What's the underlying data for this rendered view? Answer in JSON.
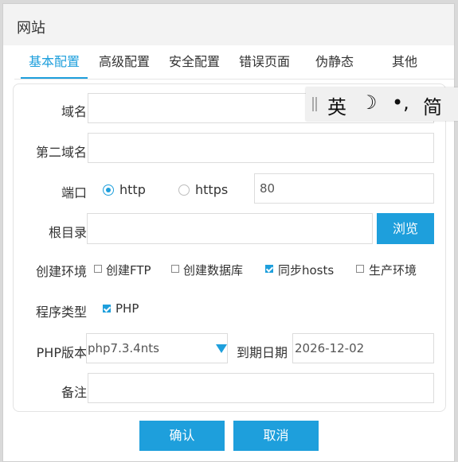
{
  "dialog": {
    "title": "网站"
  },
  "tabs": [
    {
      "label": "基本配置",
      "active": true
    },
    {
      "label": "高级配置"
    },
    {
      "label": "安全配置"
    },
    {
      "label": "错误页面"
    },
    {
      "label": "伪静态"
    },
    {
      "label": "其他"
    }
  ],
  "form": {
    "domain": {
      "label": "域名",
      "value": ""
    },
    "second_domain": {
      "label": "第二域名",
      "value": ""
    },
    "port": {
      "label": "端口",
      "options": [
        {
          "label": "http",
          "selected": true
        },
        {
          "label": "https",
          "selected": false
        }
      ],
      "value": "80"
    },
    "root": {
      "label": "根目录",
      "value": "",
      "browse_label": "浏览"
    },
    "env": {
      "label": "创建环境",
      "options": [
        {
          "label": "创建FTP",
          "checked": false
        },
        {
          "label": "创建数据库",
          "checked": false
        },
        {
          "label": "同步hosts",
          "checked": true
        },
        {
          "label": "生产环境",
          "checked": false
        }
      ]
    },
    "program_type": {
      "label": "程序类型",
      "options": [
        {
          "label": "PHP",
          "checked": true
        }
      ]
    },
    "php_version": {
      "label": "PHP版本",
      "value": "php7.3.4nts"
    },
    "expire": {
      "label": "到期日期",
      "value": "2026-12-02"
    },
    "note": {
      "label": "备注",
      "value": ""
    }
  },
  "buttons": {
    "confirm": "确认",
    "cancel": "取消"
  },
  "ime": {
    "segments": [
      "英",
      "☽",
      "•,",
      "简"
    ]
  },
  "colors": {
    "accent": "#1e9fdc"
  }
}
